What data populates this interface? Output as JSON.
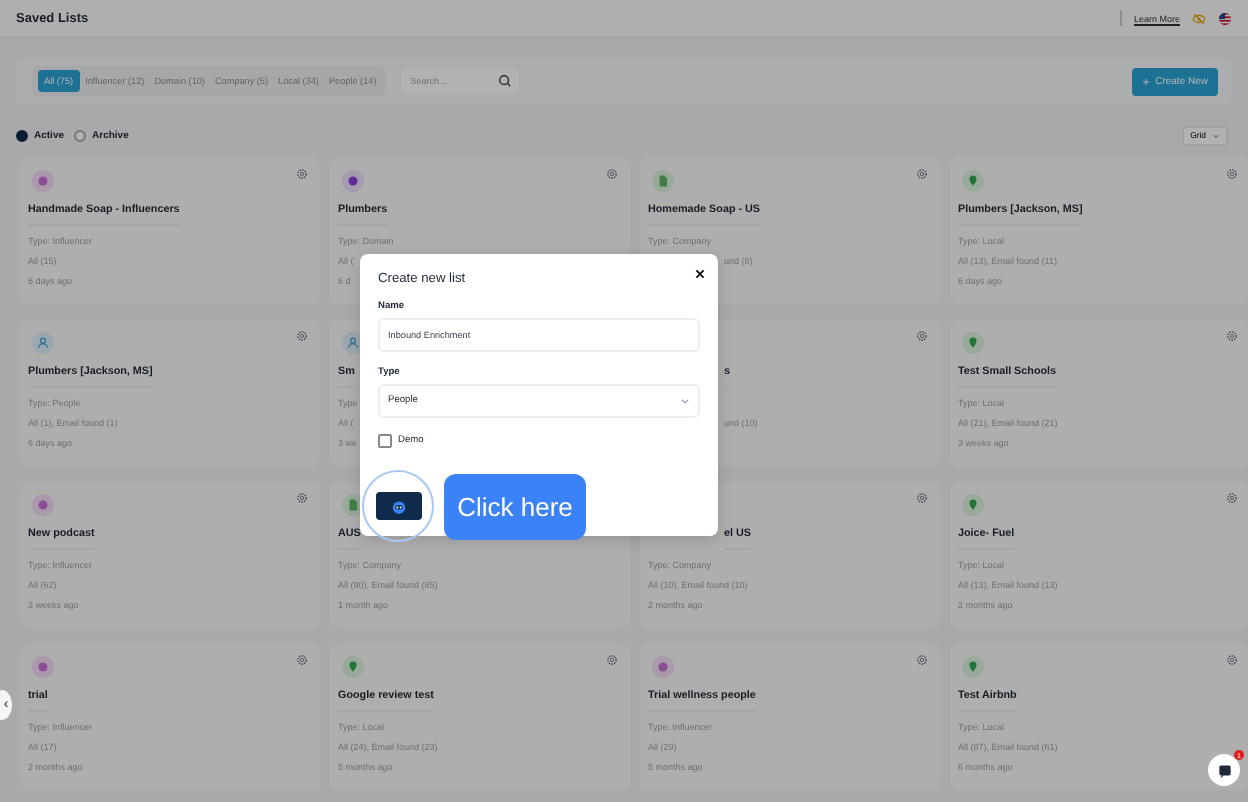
{
  "header": {
    "title": "Saved Lists",
    "learn_more": "Learn More"
  },
  "tabs": [
    {
      "label": "All (75)",
      "selected": true
    },
    {
      "label": "Influencer (12)",
      "selected": false
    },
    {
      "label": "Domain (10)",
      "selected": false
    },
    {
      "label": "Company (5)",
      "selected": false
    },
    {
      "label": "Local (34)",
      "selected": false
    },
    {
      "label": "People (14)",
      "selected": false
    }
  ],
  "search": {
    "placeholder": "Search..."
  },
  "create_button": "Create New",
  "status_filter": [
    {
      "label": "Active",
      "selected": true
    },
    {
      "label": "Archive",
      "selected": false
    }
  ],
  "view_select": "Grid",
  "cards": [
    {
      "kind": "influencer",
      "gear": true,
      "title": "Handmade Soap - Influencers",
      "lines": [
        {
          "text": "Type: Influencer"
        },
        {
          "text": "All (15)"
        },
        {
          "text": "6 days ago"
        }
      ]
    },
    {
      "kind": "domain",
      "gear": true,
      "title": "Plumbers",
      "lines": [
        {
          "text": "Type: Domain"
        },
        {
          "text": "All ("
        },
        {
          "text": "6 d"
        }
      ]
    },
    {
      "kind": "company",
      "gear": true,
      "title": "Homemade Soap - US",
      "lines": [
        {
          "text": "Type: Company"
        },
        {
          "text": "und (8)"
        }
      ]
    },
    {
      "kind": "local",
      "gear": true,
      "title": "Plumbers [Jackson, MS]",
      "lines": [
        {
          "text": "Type: Local"
        },
        {
          "text": "All (13), Email found (11)"
        },
        {
          "text": "6 days ago"
        }
      ]
    },
    {
      "kind": "people",
      "gear": true,
      "title": "Plumbers [Jackson, MS]",
      "lines": [
        {
          "text": "Type: People"
        },
        {
          "text": "All (1), Email found (1)"
        },
        {
          "text": "6 days ago"
        }
      ]
    },
    {
      "kind": "people",
      "gear": false,
      "title": "Sm",
      "lines": [
        {
          "text": "Type"
        },
        {
          "text": "All ("
        },
        {
          "text": "3 we"
        }
      ]
    },
    {
      "gear": true,
      "title": "s",
      "lines": [
        {
          "text": "und (10)"
        }
      ]
    },
    {
      "kind": "local",
      "gear": true,
      "title": "Test Small Schools",
      "lines": [
        {
          "text": "Type: Local"
        },
        {
          "text": "All (21), Email found (21)"
        },
        {
          "text": "3 weeks ago"
        }
      ]
    },
    {
      "kind": "influencer",
      "gear": true,
      "title": "New podcast",
      "lines": [
        {
          "text": "Type: Influencer"
        },
        {
          "text": "All (62)"
        },
        {
          "text": "3 weeks ago"
        }
      ]
    },
    {
      "kind": "company",
      "gear": false,
      "title": "AUS",
      "lines": [
        {
          "text": "Type: Company"
        },
        {
          "text": "All (90), Email found (85)"
        },
        {
          "text": "1 month ago"
        }
      ]
    },
    {
      "gear": true,
      "title": "el US",
      "lines": [
        {
          "text": "Type: Company"
        },
        {
          "text": "All (10), Email found (10)"
        },
        {
          "text": "2 months ago"
        }
      ]
    },
    {
      "kind": "local",
      "gear": true,
      "title": "Joice- Fuel",
      "lines": [
        {
          "text": "Type: Local"
        },
        {
          "text": "All (13), Email found (13)"
        },
        {
          "text": "2 months ago"
        }
      ]
    },
    {
      "kind": "influencer",
      "gear": true,
      "title": "trial",
      "lines": [
        {
          "text": "Type: Influencer"
        },
        {
          "text": "All (17)"
        },
        {
          "text": "2 months ago"
        }
      ]
    },
    {
      "kind": "local",
      "gear": true,
      "title": "Google review test",
      "lines": [
        {
          "text": "Type: Local"
        },
        {
          "text": "All (24), Email found (23)"
        },
        {
          "text": "5 months ago"
        }
      ]
    },
    {
      "kind": "influencer",
      "gear": true,
      "title": "Trial wellness people",
      "lines": [
        {
          "text": "Type: Influencer"
        },
        {
          "text": "All (29)"
        },
        {
          "text": "5 months ago"
        }
      ]
    },
    {
      "kind": "local",
      "gear": true,
      "title": "Test Airbnb",
      "lines": [
        {
          "text": "Type: Local"
        },
        {
          "text": "All (87), Email found (61)"
        },
        {
          "text": "6 months ago"
        }
      ]
    }
  ],
  "pager_prev": "‹",
  "chat_badge": "1",
  "modal": {
    "title": "Create new list",
    "name_label": "Name",
    "name_value": "Inbound Enrichment",
    "type_label": "Type",
    "type_value": "People",
    "demo_label": "Demo",
    "demo_checked": false
  },
  "tooltip": "Click here"
}
